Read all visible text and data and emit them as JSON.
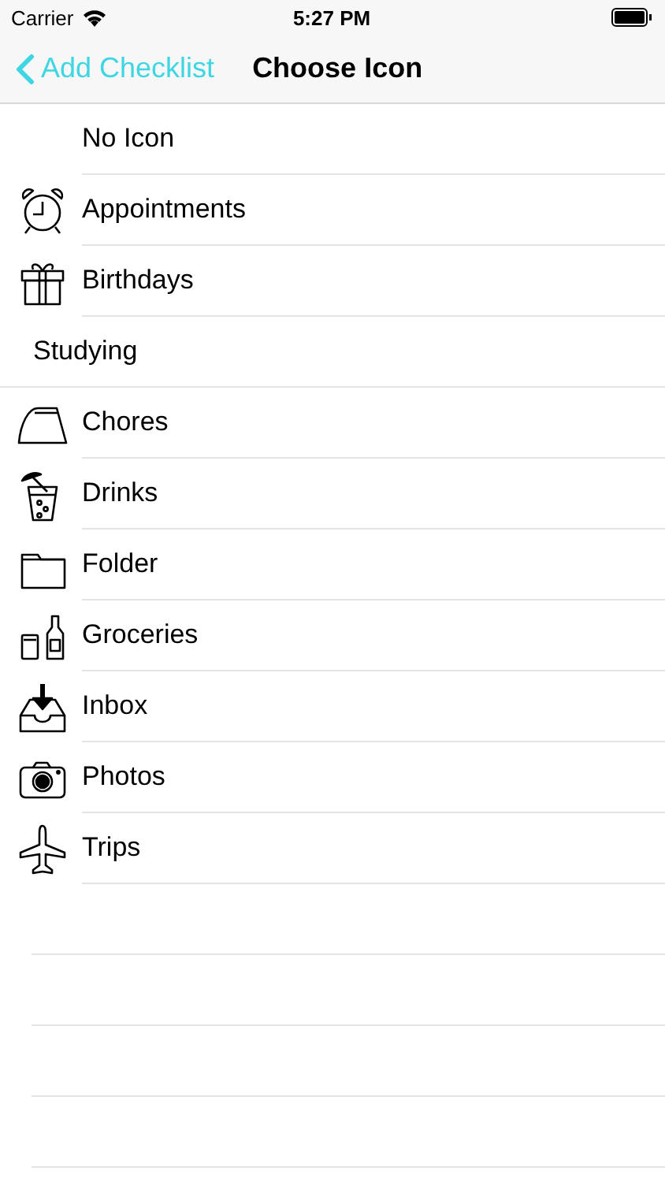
{
  "status_bar": {
    "carrier": "Carrier",
    "time": "5:27 PM"
  },
  "nav": {
    "back": "Add Checklist",
    "title": "Choose Icon"
  },
  "items": [
    {
      "label": "No Icon",
      "kind": "blank"
    },
    {
      "label": "Appointments",
      "kind": "clock"
    },
    {
      "label": "Birthdays",
      "kind": "gift"
    },
    {
      "label": "Studying",
      "kind": "plain"
    },
    {
      "label": "Chores",
      "kind": "iron"
    },
    {
      "label": "Drinks",
      "kind": "drink"
    },
    {
      "label": "Folder",
      "kind": "folder"
    },
    {
      "label": "Groceries",
      "kind": "groceries"
    },
    {
      "label": "Inbox",
      "kind": "inbox"
    },
    {
      "label": "Photos",
      "kind": "camera"
    },
    {
      "label": "Trips",
      "kind": "plane"
    }
  ]
}
